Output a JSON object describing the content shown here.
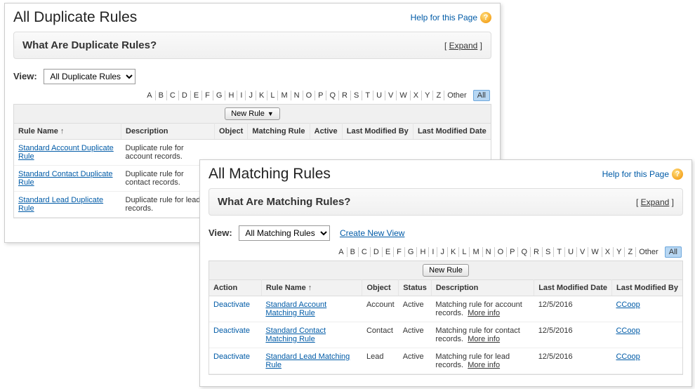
{
  "letters": [
    "A",
    "B",
    "C",
    "D",
    "E",
    "F",
    "G",
    "H",
    "I",
    "J",
    "K",
    "L",
    "M",
    "N",
    "O",
    "P",
    "Q",
    "R",
    "S",
    "T",
    "U",
    "V",
    "W",
    "X",
    "Y",
    "Z"
  ],
  "other_label": "Other",
  "all_label": "All",
  "help_text": "Help for this Page",
  "expand_label": "Expand",
  "dup": {
    "title": "All Duplicate Rules",
    "info_title": "What Are Duplicate Rules?",
    "view_label": "View:",
    "view_option": "All Duplicate Rules",
    "new_rule": "New Rule",
    "cols": {
      "rule_name": "Rule Name",
      "description": "Description",
      "object": "Object",
      "matching_rule": "Matching Rule",
      "active": "Active",
      "lmb": "Last Modified By",
      "lmd": "Last Modified Date"
    },
    "rows": [
      {
        "name": "Standard Account Duplicate Rule",
        "desc": "Duplicate rule for account records."
      },
      {
        "name": "Standard Contact Duplicate Rule",
        "desc": "Duplicate rule for contact records."
      },
      {
        "name": "Standard Lead Duplicate Rule",
        "desc": "Duplicate rule for lead records."
      }
    ]
  },
  "match": {
    "title": "All Matching Rules",
    "info_title": "What Are Matching Rules?",
    "view_label": "View:",
    "view_option": "All Matching Rules",
    "create_new_view": "Create New View",
    "new_rule": "New Rule",
    "more_info": "More info",
    "cols": {
      "action": "Action",
      "rule_name": "Rule Name",
      "object": "Object",
      "status": "Status",
      "description": "Description",
      "lmd": "Last Modified Date",
      "lmb": "Last Modified By"
    },
    "rows": [
      {
        "action": "Deactivate",
        "name": "Standard Account Matching Rule",
        "obj": "Account",
        "status": "Active",
        "desc": "Matching rule for account records.",
        "lmd": "12/5/2016",
        "lmb": "CCoop"
      },
      {
        "action": "Deactivate",
        "name": "Standard Contact Matching Rule",
        "obj": "Contact",
        "status": "Active",
        "desc": "Matching rule for contact records.",
        "lmd": "12/5/2016",
        "lmb": "CCoop"
      },
      {
        "action": "Deactivate",
        "name": "Standard Lead Matching Rule",
        "obj": "Lead",
        "status": "Active",
        "desc": "Matching rule for lead records.",
        "lmd": "12/5/2016",
        "lmb": "CCoop"
      }
    ]
  }
}
